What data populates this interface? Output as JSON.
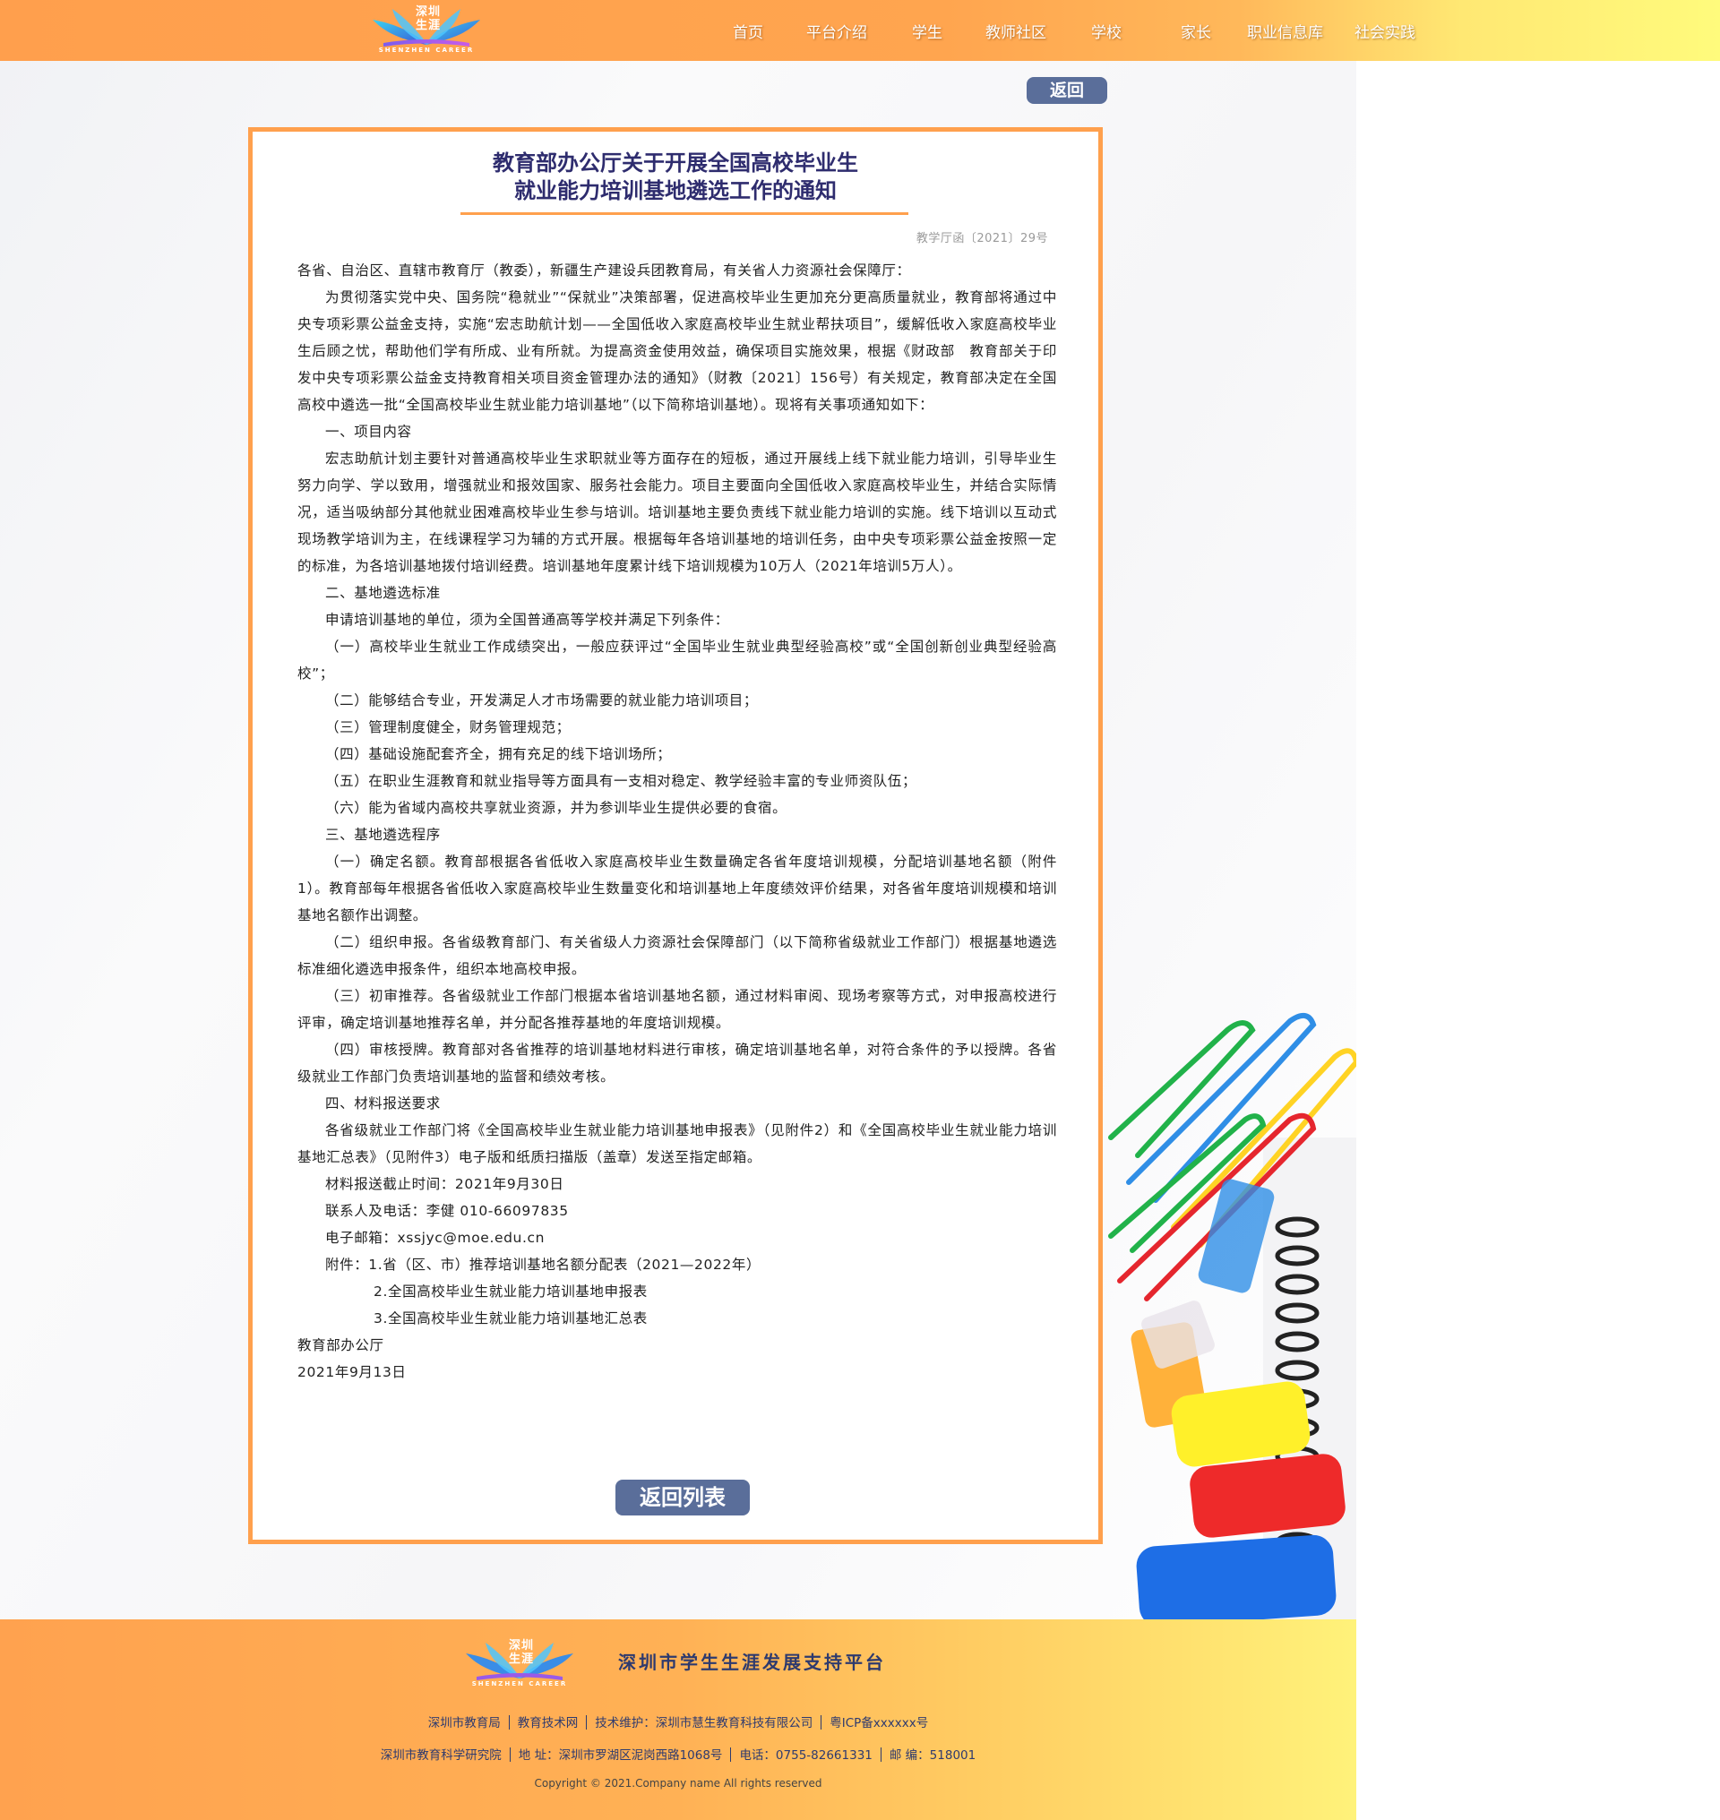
{
  "header": {
    "logo_cn": "深圳生涯",
    "logo_en": "SHENZHEN CAREER",
    "nav": [
      "首页",
      "平台介绍",
      "学生",
      "教师社区",
      "学校",
      "家长",
      "职业信息库",
      "社会实践"
    ]
  },
  "buttons": {
    "back": "返回",
    "back_list": "返回列表"
  },
  "article": {
    "title_line1": "教育部办公厅关于开展全国高校毕业生",
    "title_line2": "就业能力培训基地遴选工作的通知",
    "doc_no": "教学厅函〔2021〕29号",
    "paragraphs": [
      {
        "style": "plain",
        "text": "各省、自治区、直辖市教育厅（教委），新疆生产建设兵团教育局，有关省人力资源社会保障厅："
      },
      {
        "style": "indent",
        "text": "为贯彻落实党中央、国务院“稳就业”“保就业”决策部署，促进高校毕业生更加充分更高质量就业，教育部将通过中央专项彩票公益金支持，实施“宏志助航计划——全国低收入家庭高校毕业生就业帮扶项目”，缓解低收入家庭高校毕业生后顾之忧，帮助他们学有所成、业有所就。为提高资金使用效益，确保项目实施效果，根据《财政部　教育部关于印发中央专项彩票公益金支持教育相关项目资金管理办法的通知》（财教〔2021〕156号）有关规定，教育部决定在全国高校中遴选一批“全国高校毕业生就业能力培训基地”（以下简称培训基地）。现将有关事项通知如下："
      },
      {
        "style": "indent",
        "text": "一、项目内容"
      },
      {
        "style": "indent",
        "text": "宏志助航计划主要针对普通高校毕业生求职就业等方面存在的短板，通过开展线上线下就业能力培训，引导毕业生努力向学、学以致用，增强就业和报效国家、服务社会能力。项目主要面向全国低收入家庭高校毕业生，并结合实际情况，适当吸纳部分其他就业困难高校毕业生参与培训。培训基地主要负责线下就业能力培训的实施。线下培训以互动式现场教学培训为主，在线课程学习为辅的方式开展。根据每年各培训基地的培训任务，由中央专项彩票公益金按照一定的标准，为各培训基地拨付培训经费。培训基地年度累计线下培训规模为10万人（2021年培训5万人）。"
      },
      {
        "style": "indent",
        "text": "二、基地遴选标准"
      },
      {
        "style": "indent",
        "text": "申请培训基地的单位，须为全国普通高等学校并满足下列条件："
      },
      {
        "style": "indent",
        "text": "（一）高校毕业生就业工作成绩突出，一般应获评过“全国毕业生就业典型经验高校”或“全国创新创业典型经验高校”；"
      },
      {
        "style": "indent",
        "text": "（二）能够结合专业，开发满足人才市场需要的就业能力培训项目；"
      },
      {
        "style": "indent",
        "text": "（三）管理制度健全，财务管理规范；"
      },
      {
        "style": "indent",
        "text": "（四）基础设施配套齐全，拥有充足的线下培训场所；"
      },
      {
        "style": "indent",
        "text": "（五）在职业生涯教育和就业指导等方面具有一支相对稳定、教学经验丰富的专业师资队伍；"
      },
      {
        "style": "indent",
        "text": "（六）能为省域内高校共享就业资源，并为参训毕业生提供必要的食宿。"
      },
      {
        "style": "indent",
        "text": "三、基地遴选程序"
      },
      {
        "style": "indent",
        "text": "（一）确定名额。教育部根据各省低收入家庭高校毕业生数量确定各省年度培训规模，分配培训基地名额（附件1）。教育部每年根据各省低收入家庭高校毕业生数量变化和培训基地上年度绩效评价结果，对各省年度培训规模和培训基地名额作出调整。"
      },
      {
        "style": "indent",
        "text": "（二）组织申报。各省级教育部门、有关省级人力资源社会保障部门（以下简称省级就业工作部门）根据基地遴选标准细化遴选申报条件，组织本地高校申报。"
      },
      {
        "style": "indent",
        "text": "（三）初审推荐。各省级就业工作部门根据本省培训基地名额，通过材料审阅、现场考察等方式，对申报高校进行评审，确定培训基地推荐名单，并分配各推荐基地的年度培训规模。"
      },
      {
        "style": "indent",
        "text": "（四）审核授牌。教育部对各省推荐的培训基地材料进行审核，确定培训基地名单，对符合条件的予以授牌。各省级就业工作部门负责培训基地的监督和绩效考核。"
      },
      {
        "style": "indent",
        "text": "四、材料报送要求"
      },
      {
        "style": "indent",
        "text": "各省级就业工作部门将《全国高校毕业生就业能力培训基地申报表》（见附件2）和《全国高校毕业生就业能力培训基地汇总表》（见附件3）电子版和纸质扫描版（盖章）发送至指定邮箱。"
      },
      {
        "style": "indent",
        "text": "材料报送截止时间：2021年9月30日"
      },
      {
        "style": "indent",
        "text": "联系人及电话：李健 010-66097835"
      },
      {
        "style": "indent",
        "text": "电子邮箱：xssjyc@moe.edu.cn"
      },
      {
        "style": "indent",
        "text": "附件：1.省（区、市）推荐培训基地名额分配表（2021—2022年）"
      },
      {
        "style": "indent2",
        "text": "2.全国高校毕业生就业能力培训基地申报表"
      },
      {
        "style": "indent2",
        "text": "3.全国高校毕业生就业能力培训基地汇总表"
      },
      {
        "style": "sig",
        "text": "教育部办公厅"
      },
      {
        "style": "sig",
        "text": "2021年9月13日"
      }
    ]
  },
  "footer": {
    "logo_cn": "深圳生涯",
    "logo_en": "SHENZHEN CAREER",
    "title": "深圳市学生生涯发展支持平台",
    "row1": [
      "深圳市教育局",
      "教育技术网",
      "技术维护：深圳市慧生教育科技有限公司",
      "粤ICP备xxxxxx号"
    ],
    "row2": [
      "深圳市教育科学研究院",
      "地  址：深圳市罗湖区泥岗西路1068号",
      "电话：0755-82661331",
      "邮  编：518001"
    ],
    "copyright": "Copyright © 2021.Company name All rights reserved"
  }
}
